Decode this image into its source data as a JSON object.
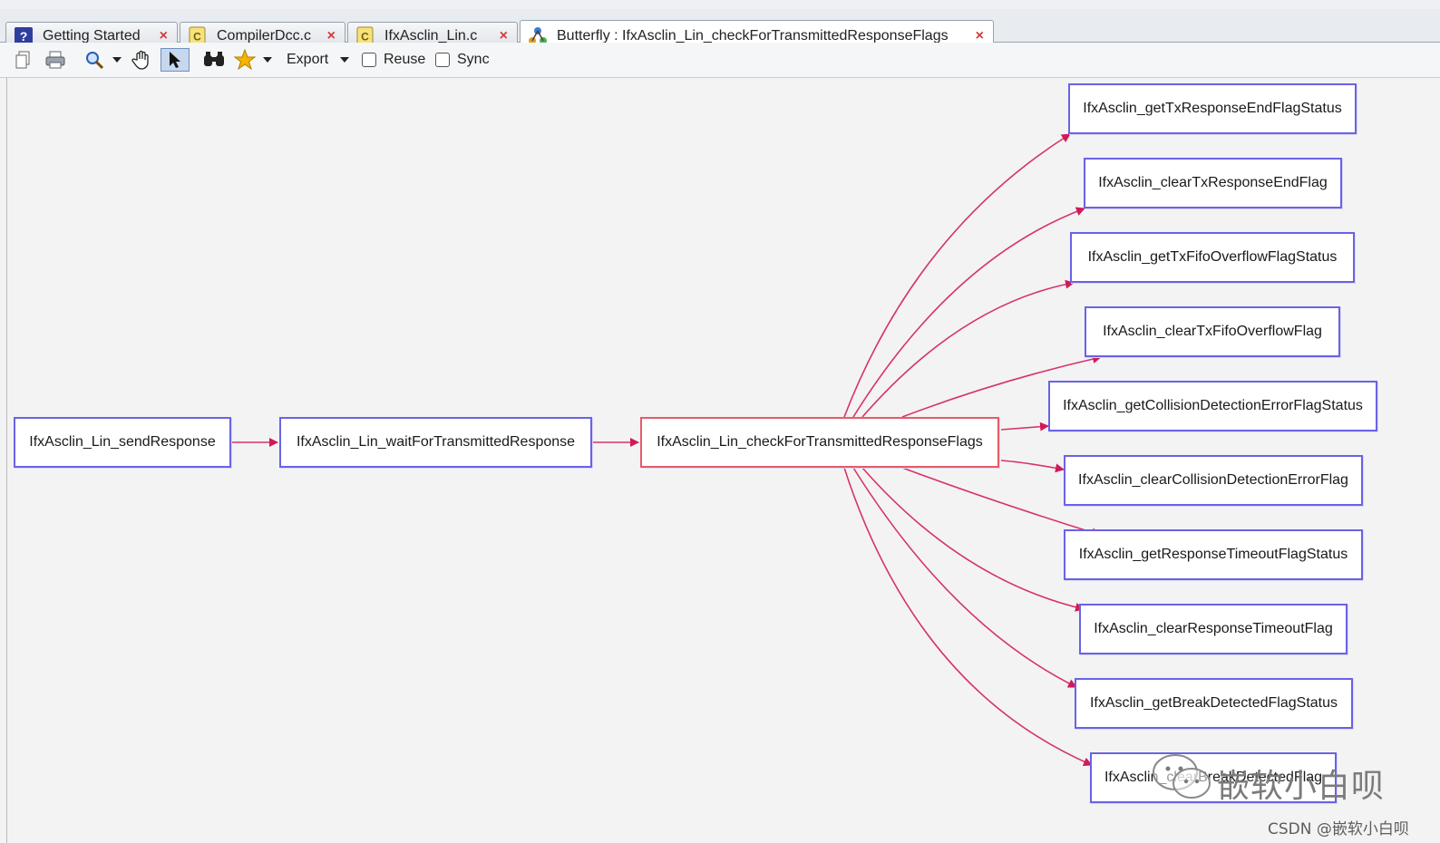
{
  "tabs": [
    {
      "label": "Getting Started",
      "icon": "help-book-icon"
    },
    {
      "label": "CompilerDcc.c",
      "icon": "c-file-icon"
    },
    {
      "label": "IfxAsclin_Lin.c",
      "icon": "c-file-icon"
    },
    {
      "label": "Butterfly : IfxAsclin_Lin_checkForTransmittedResponseFlags",
      "icon": "butterfly-graph-icon"
    }
  ],
  "tab_close_glyph": "×",
  "toolbar": {
    "export_label": "Export",
    "reuse_label": "Reuse",
    "sync_label": "Sync",
    "reuse_checked": false,
    "sync_checked": false
  },
  "graph": {
    "callers": [
      "IfxAsclin_Lin_sendResponse",
      "IfxAsclin_Lin_waitForTransmittedResponse"
    ],
    "center": "IfxAsclin_Lin_checkForTransmittedResponseFlags",
    "callees": [
      "IfxAsclin_getTxResponseEndFlagStatus",
      "IfxAsclin_clearTxResponseEndFlag",
      "IfxAsclin_getTxFifoOverflowFlagStatus",
      "IfxAsclin_clearTxFifoOverflowFlag",
      "IfxAsclin_getCollisionDetectionErrorFlagStatus",
      "IfxAsclin_clearCollisionDetectionErrorFlag",
      "IfxAsclin_getResponseTimeoutFlagStatus",
      "IfxAsclin_clearResponseTimeoutFlag",
      "IfxAsclin_getBreakDetectedFlagStatus",
      "IfxAsclin_clearBreakDetectedFlag"
    ]
  },
  "colors": {
    "node_border": "#6a62e6",
    "center_border": "#e55b6a",
    "edge": "#d6336c"
  },
  "watermark": {
    "brand": "嵌软小白呗",
    "credit": "CSDN @嵌软小白呗"
  }
}
